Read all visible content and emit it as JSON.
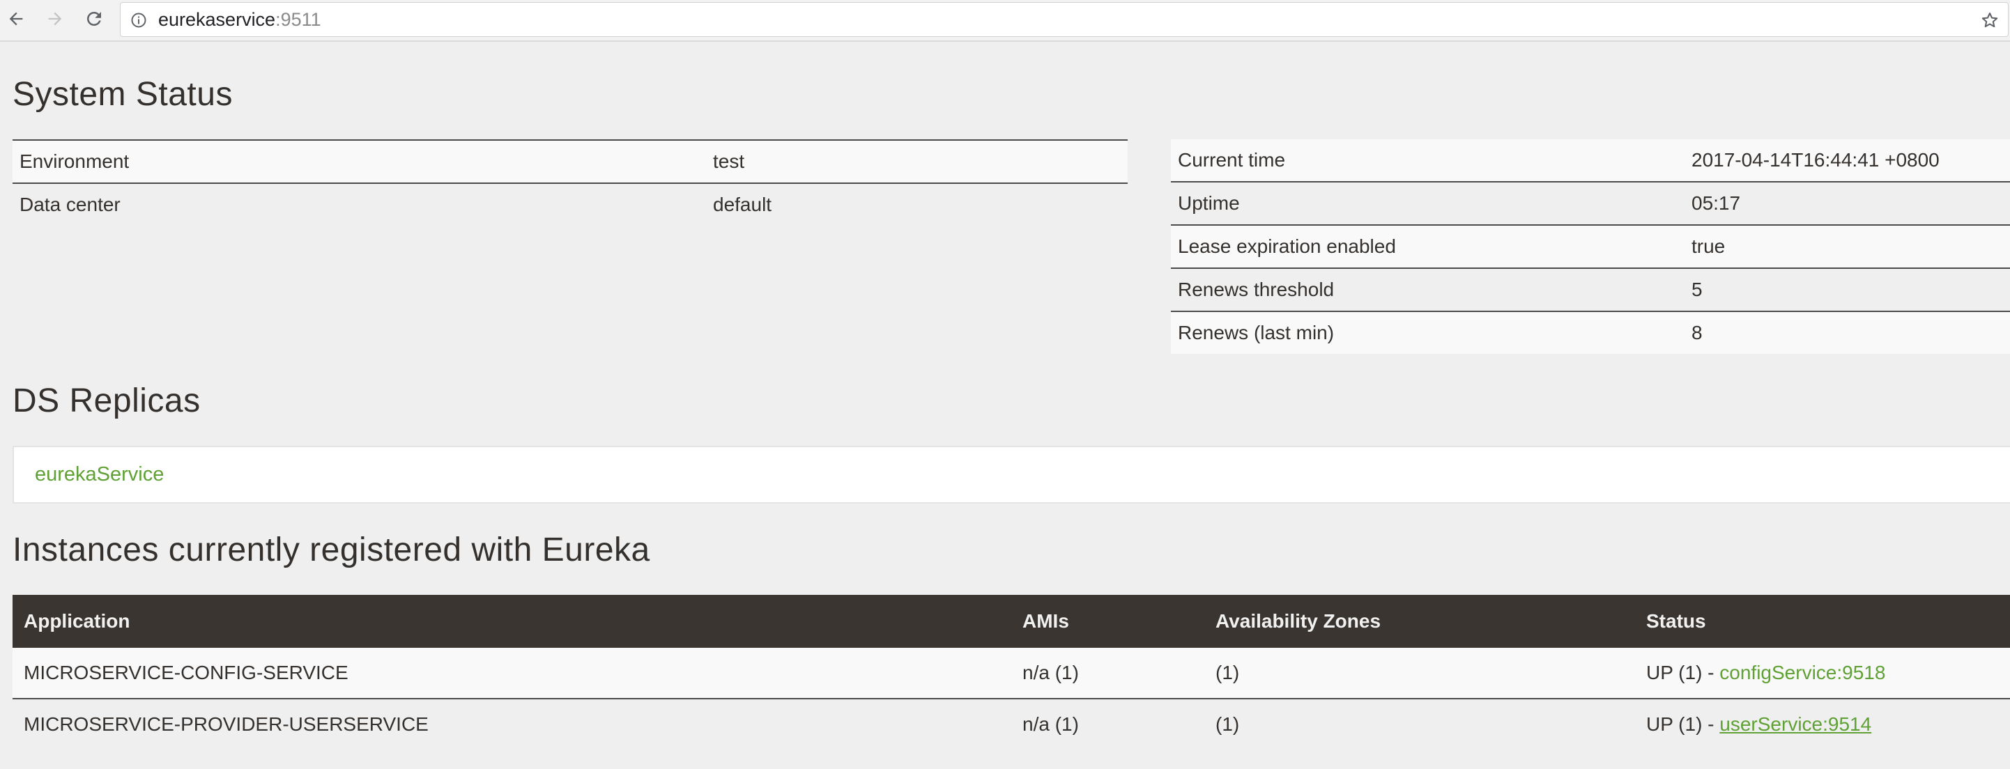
{
  "browser": {
    "url_host": "eurekaservice",
    "url_port": ":9511"
  },
  "system_status": {
    "title": "System Status",
    "left_table": [
      {
        "label": "Environment",
        "value": "test"
      },
      {
        "label": "Data center",
        "value": "default"
      }
    ],
    "right_table": [
      {
        "label": "Current time",
        "value": "2017-04-14T16:44:41 +0800"
      },
      {
        "label": "Uptime",
        "value": "05:17"
      },
      {
        "label": "Lease expiration enabled",
        "value": "true"
      },
      {
        "label": "Renews threshold",
        "value": "5"
      },
      {
        "label": "Renews (last min)",
        "value": "8"
      }
    ]
  },
  "ds_replicas": {
    "title": "DS Replicas",
    "items": [
      "eurekaService"
    ]
  },
  "instances": {
    "title": "Instances currently registered with Eureka",
    "columns": [
      "Application",
      "AMIs",
      "Availability Zones",
      "Status"
    ],
    "rows": [
      {
        "application": "MICROSERVICE-CONFIG-SERVICE",
        "amis": "n/a (1)",
        "zones": "(1)",
        "status_prefix": "UP (1) - ",
        "status_link": "configService:9518"
      },
      {
        "application": "MICROSERVICE-PROVIDER-USERSERVICE",
        "amis": "n/a (1)",
        "zones": "(1)",
        "status_prefix": "UP (1) - ",
        "status_link": "userService:9514"
      }
    ]
  },
  "colors": {
    "link_green": "#5fa134",
    "header_dark": "#3a3530",
    "text": "#34302d",
    "page_bg": "#efefef"
  },
  "icons": [
    "back-arrow-icon",
    "forward-arrow-icon",
    "reload-icon",
    "info-icon",
    "star-icon"
  ]
}
